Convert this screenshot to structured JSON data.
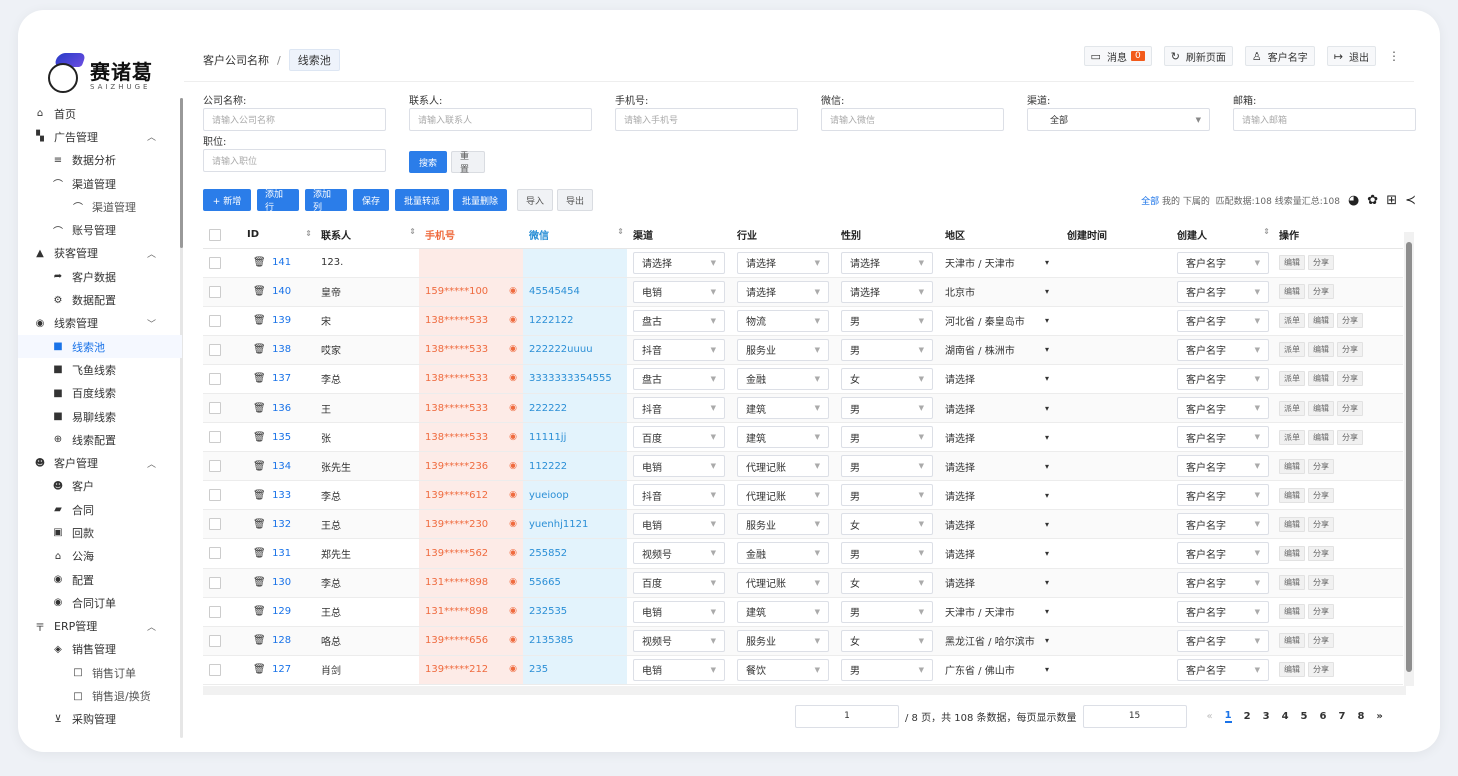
{
  "brand": {
    "name_cn": "赛诸葛",
    "name_en": "SAIZHUGE"
  },
  "sidebar": [
    {
      "level": 1,
      "icon": "⌂",
      "icon_name": "home-icon",
      "label": "首页"
    },
    {
      "level": 1,
      "icon": "▚",
      "icon_name": "ad-icon",
      "label": "广告管理",
      "arrow": "^"
    },
    {
      "level": 2,
      "icon": "≡",
      "icon_name": "list-icon",
      "label": "数据分析"
    },
    {
      "level": 2,
      "icon": "⌒",
      "icon_name": "channel-icon",
      "label": "渠道管理"
    },
    {
      "level": 3,
      "icon": "⌒",
      "icon_name": "channel-icon",
      "label": "渠道管理"
    },
    {
      "level": 2,
      "icon": "⌒",
      "icon_name": "account-icon",
      "label": "账号管理"
    },
    {
      "level": 1,
      "icon": "▲",
      "icon_name": "acquire-icon",
      "label": "获客管理",
      "arrow": "^"
    },
    {
      "level": 2,
      "icon": "➦",
      "icon_name": "customer-data-icon",
      "label": "客户数据"
    },
    {
      "level": 2,
      "icon": "⚙",
      "icon_name": "config-icon",
      "label": "数据配置"
    },
    {
      "level": 1,
      "icon": "◉",
      "icon_name": "lead-icon",
      "label": "线索管理",
      "arrow": "v"
    },
    {
      "level": 2,
      "icon": "■",
      "icon_name": "folder-icon",
      "label": "线索池",
      "active": true
    },
    {
      "level": 2,
      "icon": "■",
      "icon_name": "folder-icon",
      "label": "飞鱼线索"
    },
    {
      "level": 2,
      "icon": "■",
      "icon_name": "folder-icon",
      "label": "百度线索"
    },
    {
      "level": 2,
      "icon": "■",
      "icon_name": "folder-icon",
      "label": "易聊线索"
    },
    {
      "level": 2,
      "icon": "⊕",
      "icon_name": "lead-config-icon",
      "label": "线索配置"
    },
    {
      "level": 1,
      "icon": "☻",
      "icon_name": "customers-icon",
      "label": "客户管理",
      "arrow": "^"
    },
    {
      "level": 2,
      "icon": "☻",
      "icon_name": "customer-icon",
      "label": "客户"
    },
    {
      "level": 2,
      "icon": "▰",
      "icon_name": "contract-icon",
      "label": "合同"
    },
    {
      "level": 2,
      "icon": "▣",
      "icon_name": "payment-icon",
      "label": "回款"
    },
    {
      "level": 2,
      "icon": "⌂",
      "icon_name": "pool-icon",
      "label": "公海"
    },
    {
      "level": 2,
      "icon": "◉",
      "icon_name": "settings-icon",
      "label": "配置"
    },
    {
      "level": 2,
      "icon": "◉",
      "icon_name": "contract-order-icon",
      "label": "合同订单"
    },
    {
      "level": 1,
      "icon": "〒",
      "icon_name": "erp-icon",
      "label": "ERP管理",
      "arrow": "^"
    },
    {
      "level": 2,
      "icon": "◈",
      "icon_name": "sales-icon",
      "label": "销售管理"
    },
    {
      "level": 3,
      "icon": "□",
      "icon_name": "order-icon",
      "label": "销售订单"
    },
    {
      "level": 3,
      "icon": "□",
      "icon_name": "return-icon",
      "label": "销售退/换货"
    },
    {
      "level": 2,
      "icon": "⊻",
      "icon_name": "purchase-icon",
      "label": "采购管理"
    }
  ],
  "header": {
    "breadcrumb_root": "客户公司名称",
    "breadcrumb_sep": "/",
    "breadcrumb_current": "线索池",
    "messages_label": "消息",
    "messages_count": "0",
    "refresh_label": "刷新页面",
    "user_label": "客户名字",
    "logout_label": "退出"
  },
  "filters": {
    "company_label": "公司名称:",
    "company_placeholder": "请输入公司名称",
    "contact_label": "联系人:",
    "contact_placeholder": "请输入联系人",
    "phone_label": "手机号:",
    "phone_placeholder": "请输入手机号",
    "wechat_label": "微信:",
    "wechat_placeholder": "请输入微信",
    "channel_label": "渠道:",
    "channel_value": "全部",
    "email_label": "邮箱:",
    "email_placeholder": "请输入邮箱",
    "position_label": "职位:",
    "position_placeholder": "请输入职位",
    "search_label": "搜索",
    "reset_label": "重置"
  },
  "toolbar": {
    "add": "+ 新增",
    "add_row": "添加行",
    "add_col": "添加列",
    "save": "保存",
    "batch_transfer": "批量转派",
    "batch_delete": "批量删除",
    "import": "导入",
    "export": "导出",
    "scope_all": "全部",
    "scope_mine": "我的",
    "scope_sub": "下属的",
    "summary": "匹配数据:108 线索量汇总:108"
  },
  "table": {
    "columns": {
      "id": "ID",
      "contact": "联系人",
      "phone": "手机号",
      "wechat": "微信",
      "channel": "渠道",
      "industry": "行业",
      "gender": "性别",
      "region": "地区",
      "created_time": "创建时间",
      "creator": "创建人",
      "ops": "操作"
    },
    "rows": [
      {
        "id": "141",
        "contact": "123.",
        "phone": "",
        "wechat": "",
        "channel": "请选择",
        "industry": "请选择",
        "gender": "请选择",
        "region": "天津市 / 天津市",
        "creator": "客户名字",
        "ops": [
          "编辑",
          "分享"
        ]
      },
      {
        "id": "140",
        "contact": "皇帝",
        "phone": "159*****100",
        "wechat": "45545454",
        "channel": "电销",
        "industry": "请选择",
        "gender": "请选择",
        "region": "北京市",
        "creator": "客户名字",
        "ops": [
          "编辑",
          "分享"
        ]
      },
      {
        "id": "139",
        "contact": "宋",
        "phone": "138*****533",
        "wechat": "1222122",
        "channel": "盘古",
        "industry": "物流",
        "gender": "男",
        "region": "河北省 / 秦皇岛市",
        "creator": "客户名字",
        "ops": [
          "派单",
          "编辑",
          "分享"
        ]
      },
      {
        "id": "138",
        "contact": "哎家",
        "phone": "138*****533",
        "wechat": "222222uuuu",
        "channel": "抖音",
        "industry": "服务业",
        "gender": "男",
        "region": "湖南省 / 株洲市",
        "creator": "客户名字",
        "ops": [
          "派单",
          "编辑",
          "分享"
        ]
      },
      {
        "id": "137",
        "contact": "李总",
        "phone": "138*****533",
        "wechat": "3333333354555",
        "channel": "盘古",
        "industry": "金融",
        "gender": "女",
        "region": "请选择",
        "creator": "客户名字",
        "ops": [
          "派单",
          "编辑",
          "分享"
        ]
      },
      {
        "id": "136",
        "contact": "王",
        "phone": "138*****533",
        "wechat": "222222",
        "channel": "抖音",
        "industry": "建筑",
        "gender": "男",
        "region": "请选择",
        "creator": "客户名字",
        "ops": [
          "派单",
          "编辑",
          "分享"
        ]
      },
      {
        "id": "135",
        "contact": "张",
        "phone": "138*****533",
        "wechat": "11111jj",
        "channel": "百度",
        "industry": "建筑",
        "gender": "男",
        "region": "请选择",
        "creator": "客户名字",
        "ops": [
          "派单",
          "编辑",
          "分享"
        ]
      },
      {
        "id": "134",
        "contact": "张先生",
        "phone": "139*****236",
        "wechat": "112222",
        "channel": "电销",
        "industry": "代理记账",
        "gender": "男",
        "region": "请选择",
        "creator": "客户名字",
        "ops": [
          "编辑",
          "分享"
        ]
      },
      {
        "id": "133",
        "contact": "李总",
        "phone": "139*****612",
        "wechat": "yueioop",
        "channel": "抖音",
        "industry": "代理记账",
        "gender": "男",
        "region": "请选择",
        "creator": "客户名字",
        "ops": [
          "编辑",
          "分享"
        ]
      },
      {
        "id": "132",
        "contact": "王总",
        "phone": "139*****230",
        "wechat": "yuenhj1121",
        "channel": "电销",
        "industry": "服务业",
        "gender": "女",
        "region": "请选择",
        "creator": "客户名字",
        "ops": [
          "编辑",
          "分享"
        ]
      },
      {
        "id": "131",
        "contact": "郑先生",
        "phone": "139*****562",
        "wechat": "255852",
        "channel": "视频号",
        "industry": "金融",
        "gender": "男",
        "region": "请选择",
        "creator": "客户名字",
        "ops": [
          "编辑",
          "分享"
        ]
      },
      {
        "id": "130",
        "contact": "李总",
        "phone": "131*****898",
        "wechat": "55665",
        "channel": "百度",
        "industry": "代理记账",
        "gender": "女",
        "region": "请选择",
        "creator": "客户名字",
        "ops": [
          "编辑",
          "分享"
        ]
      },
      {
        "id": "129",
        "contact": "王总",
        "phone": "131*****898",
        "wechat": "232535",
        "channel": "电销",
        "industry": "建筑",
        "gender": "男",
        "region": "天津市 / 天津市",
        "creator": "客户名字",
        "ops": [
          "编辑",
          "分享"
        ]
      },
      {
        "id": "128",
        "contact": "咯总",
        "phone": "139*****656",
        "wechat": "2135385",
        "channel": "视频号",
        "industry": "服务业",
        "gender": "女",
        "region": "黑龙江省 / 哈尔滨市",
        "creator": "客户名字",
        "ops": [
          "编辑",
          "分享"
        ]
      },
      {
        "id": "127",
        "contact": "肖剑",
        "phone": "139*****212",
        "wechat": "235",
        "channel": "电销",
        "industry": "餐饮",
        "gender": "男",
        "region": "广东省 / 佛山市",
        "creator": "客户名字",
        "ops": [
          "编辑",
          "分享"
        ]
      }
    ]
  },
  "pagination": {
    "page_input": "1",
    "info": "/ 8 页，共 108 条数据，每页显示数量",
    "page_size": "15",
    "prev": "«",
    "next": "»",
    "pages": [
      "1",
      "2",
      "3",
      "4",
      "5",
      "6",
      "7",
      "8"
    ],
    "current": "1"
  },
  "colors": {
    "accent": "#2b7de9",
    "phone_bg": "#fdebe7",
    "wechat_bg": "#e3f3fc",
    "badge": "#f25a1a"
  }
}
